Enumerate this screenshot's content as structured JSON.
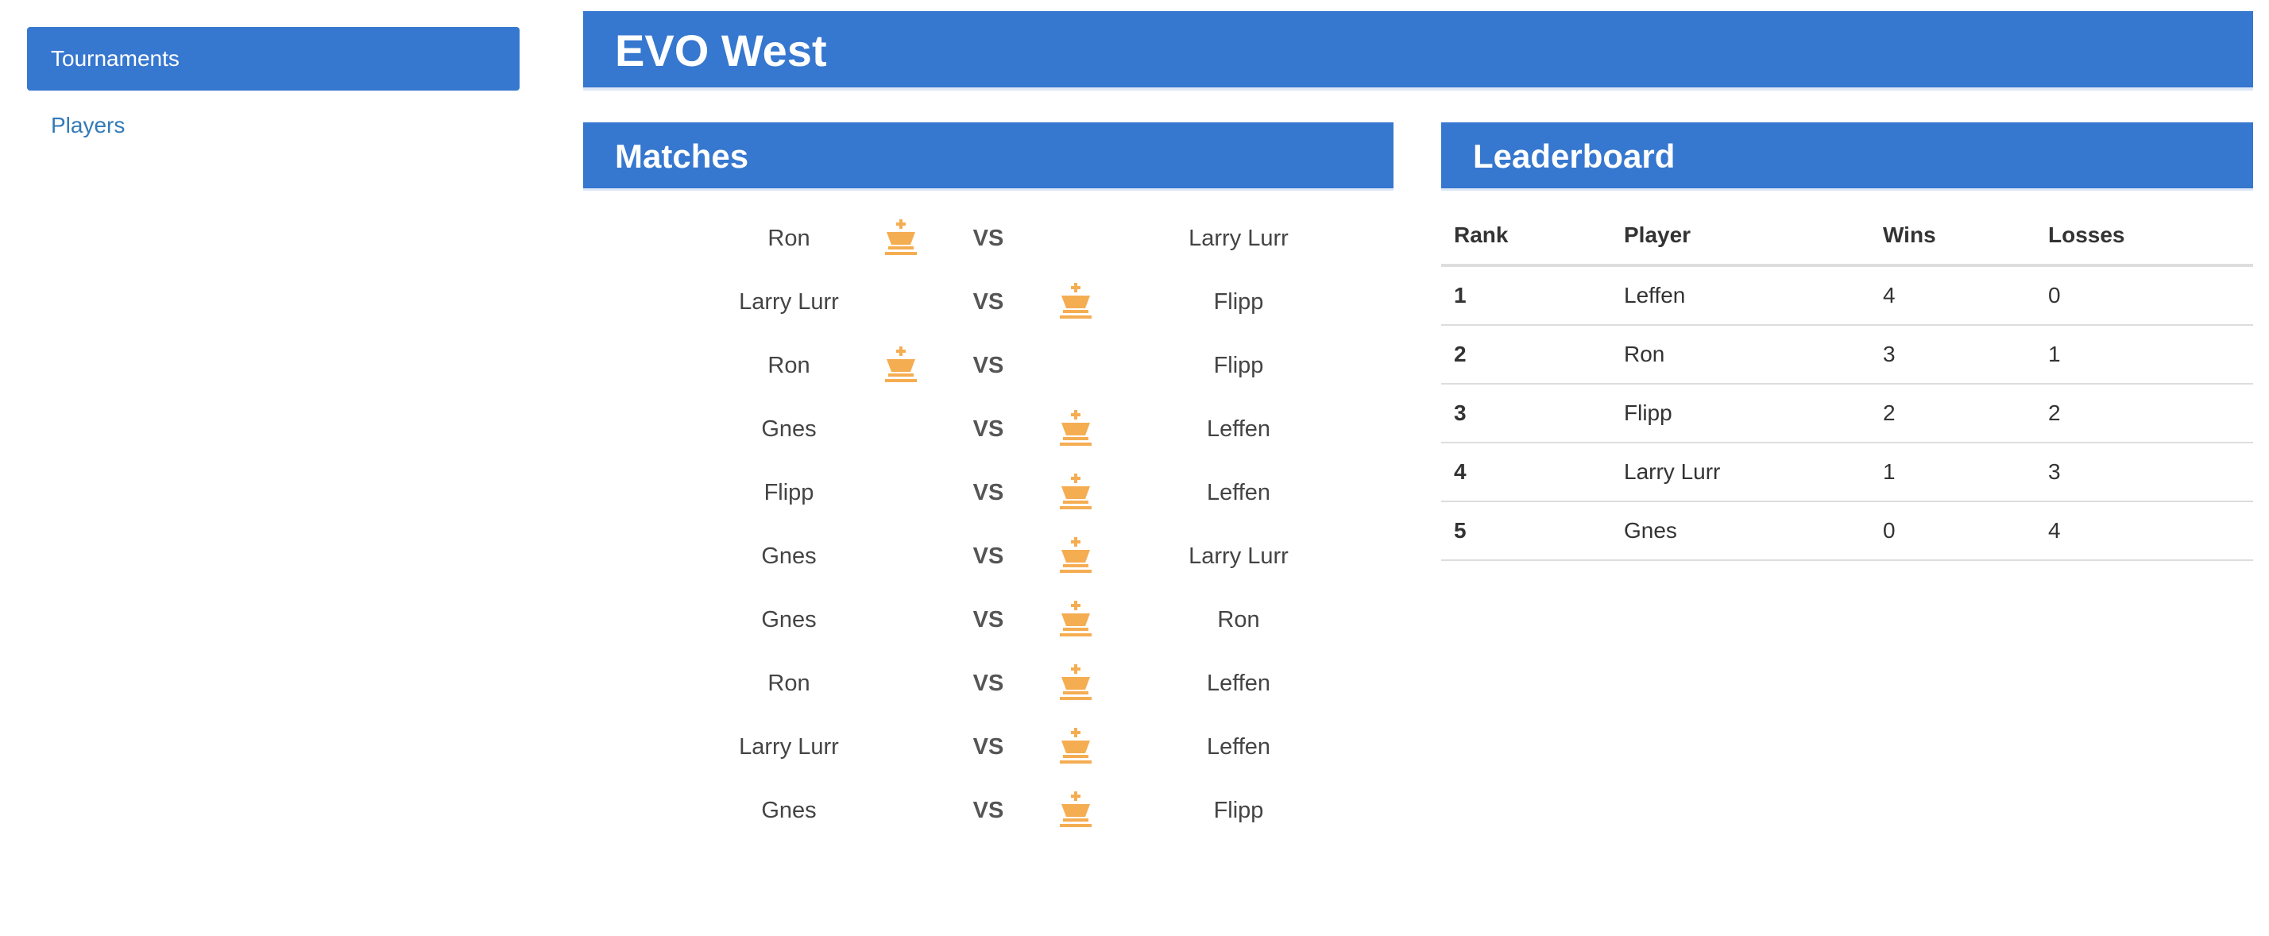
{
  "sidebar": {
    "items": [
      {
        "label": "Tournaments",
        "active": true
      },
      {
        "label": "Players",
        "active": false
      }
    ]
  },
  "header": {
    "title": "EVO West"
  },
  "matches": {
    "title": "Matches",
    "vs_label": "VS",
    "rows": [
      {
        "player1": "Ron",
        "player2": "Larry Lurr",
        "winner": "player1"
      },
      {
        "player1": "Larry Lurr",
        "player2": "Flipp",
        "winner": "player2"
      },
      {
        "player1": "Ron",
        "player2": "Flipp",
        "winner": "player1"
      },
      {
        "player1": "Gnes",
        "player2": "Leffen",
        "winner": "player2"
      },
      {
        "player1": "Flipp",
        "player2": "Leffen",
        "winner": "player2"
      },
      {
        "player1": "Gnes",
        "player2": "Larry Lurr",
        "winner": "player2"
      },
      {
        "player1": "Gnes",
        "player2": "Ron",
        "winner": "player2"
      },
      {
        "player1": "Ron",
        "player2": "Leffen",
        "winner": "player2"
      },
      {
        "player1": "Larry Lurr",
        "player2": "Leffen",
        "winner": "player2"
      },
      {
        "player1": "Gnes",
        "player2": "Flipp",
        "winner": "player2"
      }
    ]
  },
  "leaderboard": {
    "title": "Leaderboard",
    "columns": [
      "Rank",
      "Player",
      "Wins",
      "Losses"
    ],
    "rows": [
      {
        "rank": "1",
        "player": "Leffen",
        "wins": "4",
        "losses": "0"
      },
      {
        "rank": "2",
        "player": "Ron",
        "wins": "3",
        "losses": "1"
      },
      {
        "rank": "3",
        "player": "Flipp",
        "wins": "2",
        "losses": "2"
      },
      {
        "rank": "4",
        "player": "Larry Lurr",
        "wins": "1",
        "losses": "3"
      },
      {
        "rank": "5",
        "player": "Gnes",
        "wins": "0",
        "losses": "4"
      }
    ]
  },
  "icons": {
    "winner": "crown-icon"
  },
  "colors": {
    "primary": "#3677cf",
    "crown": "#f5ad52",
    "link": "#337ab7"
  }
}
